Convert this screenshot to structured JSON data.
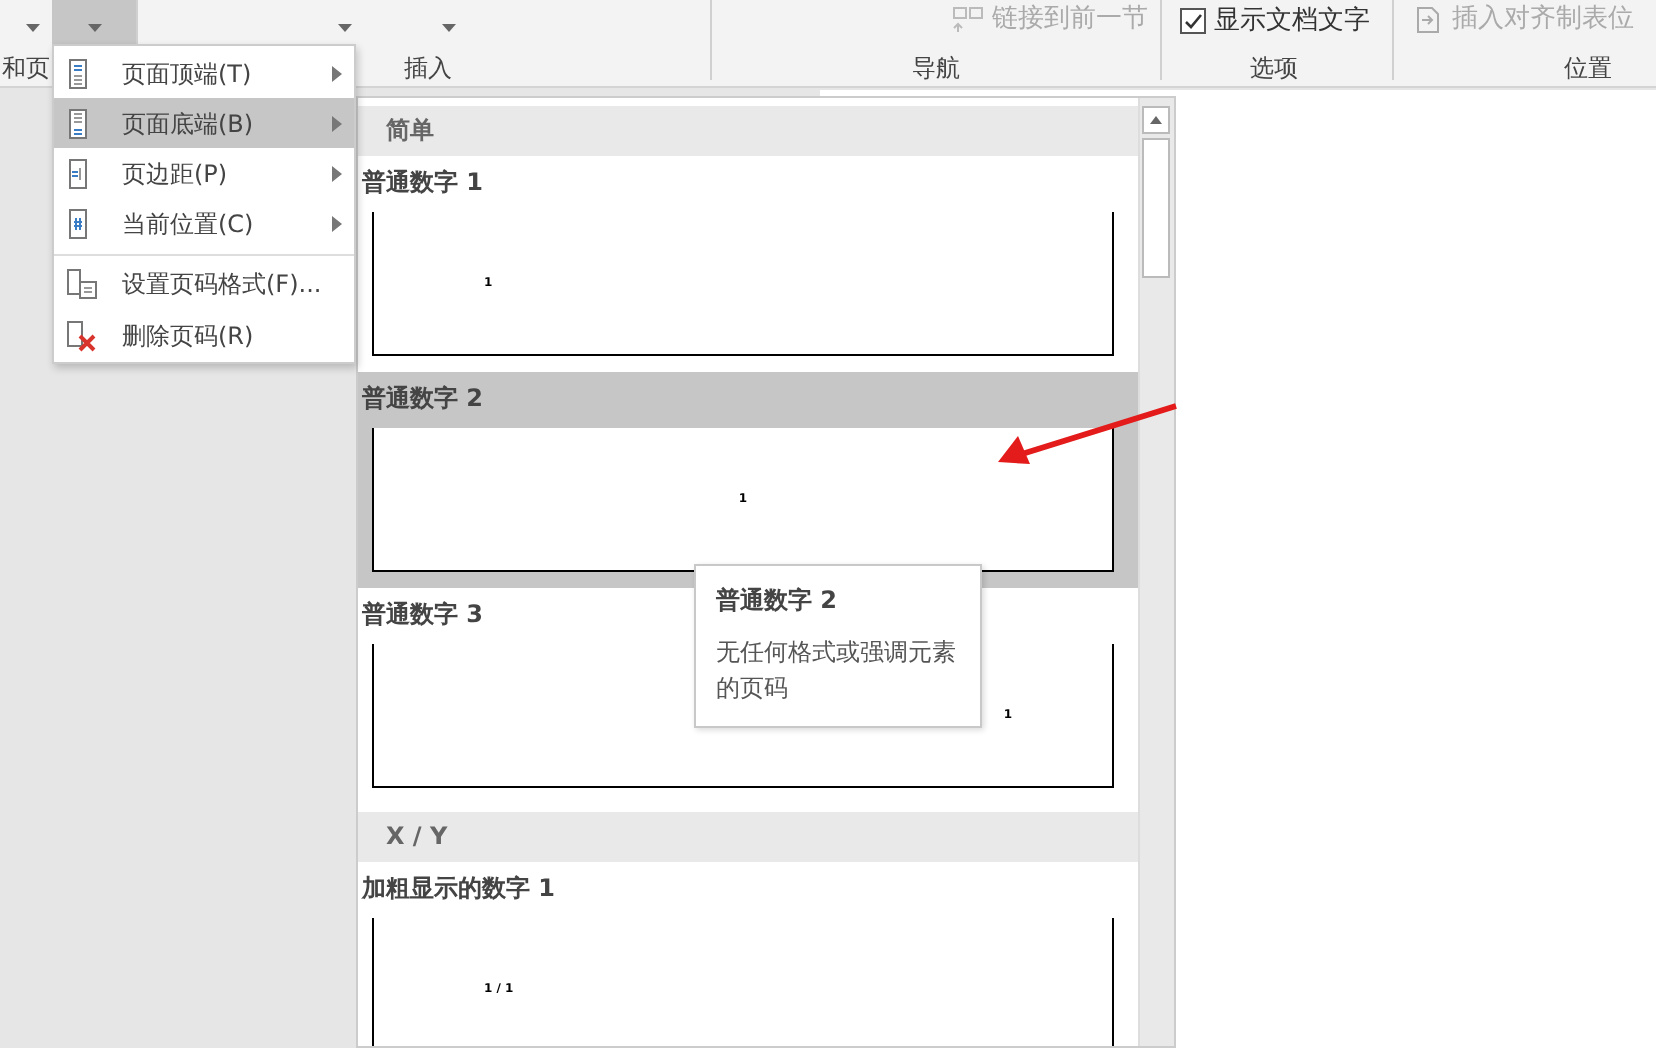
{
  "ribbon": {
    "top_buttons": [
      {
        "selected": false
      },
      {
        "selected": true
      },
      {
        "selected": false
      },
      {
        "selected": false
      }
    ],
    "link_button": {
      "label": "链接到前一节",
      "disabled": true
    },
    "option": {
      "label": "显示文档文字",
      "checked": true
    },
    "tab_button": {
      "label": "插入对齐制表位",
      "disabled": true
    },
    "groups": [
      "和页",
      "插入",
      "导航",
      "选项",
      "位置"
    ]
  },
  "menu": [
    {
      "label": "页面顶端(T)",
      "selected": false,
      "submenu": true,
      "separator_before": false
    },
    {
      "label": "页面底端(B)",
      "selected": true,
      "submenu": true,
      "separator_before": false
    },
    {
      "label": "页边距(P)",
      "selected": false,
      "submenu": true,
      "separator_before": false
    },
    {
      "label": "当前位置(C)",
      "selected": false,
      "submenu": true,
      "separator_before": false
    },
    {
      "label": "设置页码格式(F)...",
      "selected": false,
      "submenu": false,
      "separator_before": true
    },
    {
      "label": "删除页码(R)",
      "selected": false,
      "submenu": false,
      "separator_before": false
    }
  ],
  "gallery": [
    {
      "kind": "section",
      "label": "简单"
    },
    {
      "kind": "item",
      "label": "普通数字 1",
      "preview": {
        "kind": "left",
        "number": "1"
      },
      "selected": false
    },
    {
      "kind": "item",
      "label": "普通数字 2",
      "preview": {
        "kind": "center",
        "number": "1"
      },
      "selected": true
    },
    {
      "kind": "item",
      "label": "普通数字 3",
      "preview": {
        "kind": "right",
        "number": "1"
      },
      "selected": false
    },
    {
      "kind": "section",
      "label": "X / Y"
    },
    {
      "kind": "item",
      "label": "加粗显示的数字 1",
      "preview": {
        "kind": "left",
        "number": "1 / 1"
      },
      "selected": false
    }
  ],
  "tooltip": {
    "title": "普通数字 2",
    "text": "无任何格式或强调元素的页码"
  }
}
